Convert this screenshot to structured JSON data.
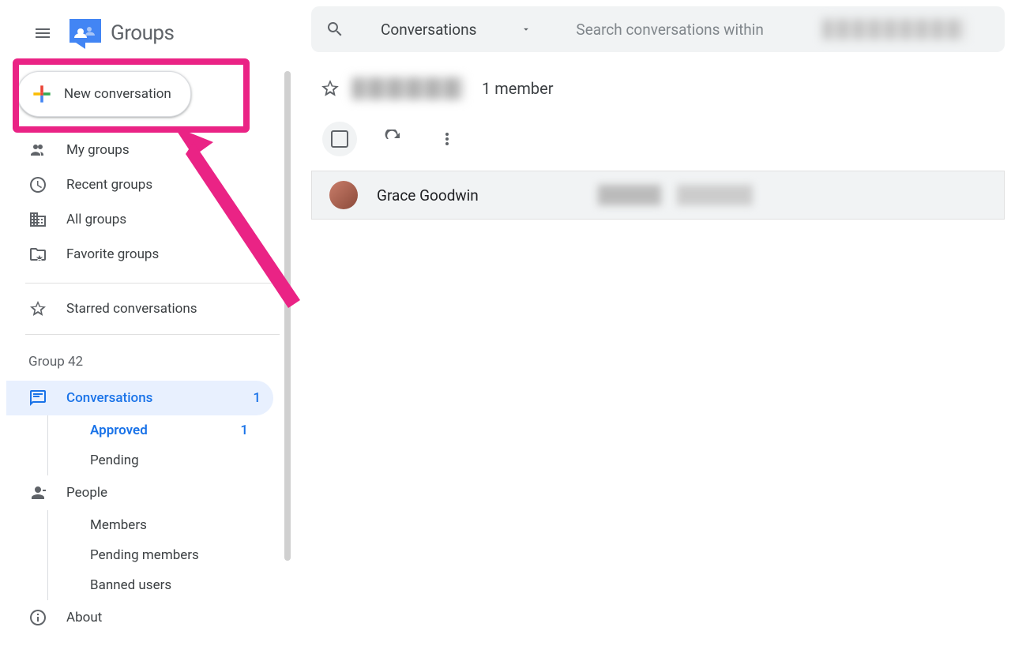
{
  "header": {
    "product": "Groups"
  },
  "newConversation": {
    "label": "New conversation"
  },
  "nav": {
    "myGroups": "My groups",
    "recentGroups": "Recent groups",
    "allGroups": "All groups",
    "favoriteGroups": "Favorite groups",
    "starred": "Starred conversations"
  },
  "groupSection": {
    "label": "Group 42",
    "conversations": {
      "label": "Conversations",
      "count": "1"
    },
    "approved": {
      "label": "Approved",
      "count": "1"
    },
    "pending": "Pending",
    "people": "People",
    "members": "Members",
    "pendingMembers": "Pending members",
    "bannedUsers": "Banned users",
    "about": "About"
  },
  "search": {
    "filter": "Conversations",
    "placeholder": "Search conversations within"
  },
  "groupHeader": {
    "members": "1 member"
  },
  "conversation": {
    "sender": "Grace Goodwin"
  }
}
